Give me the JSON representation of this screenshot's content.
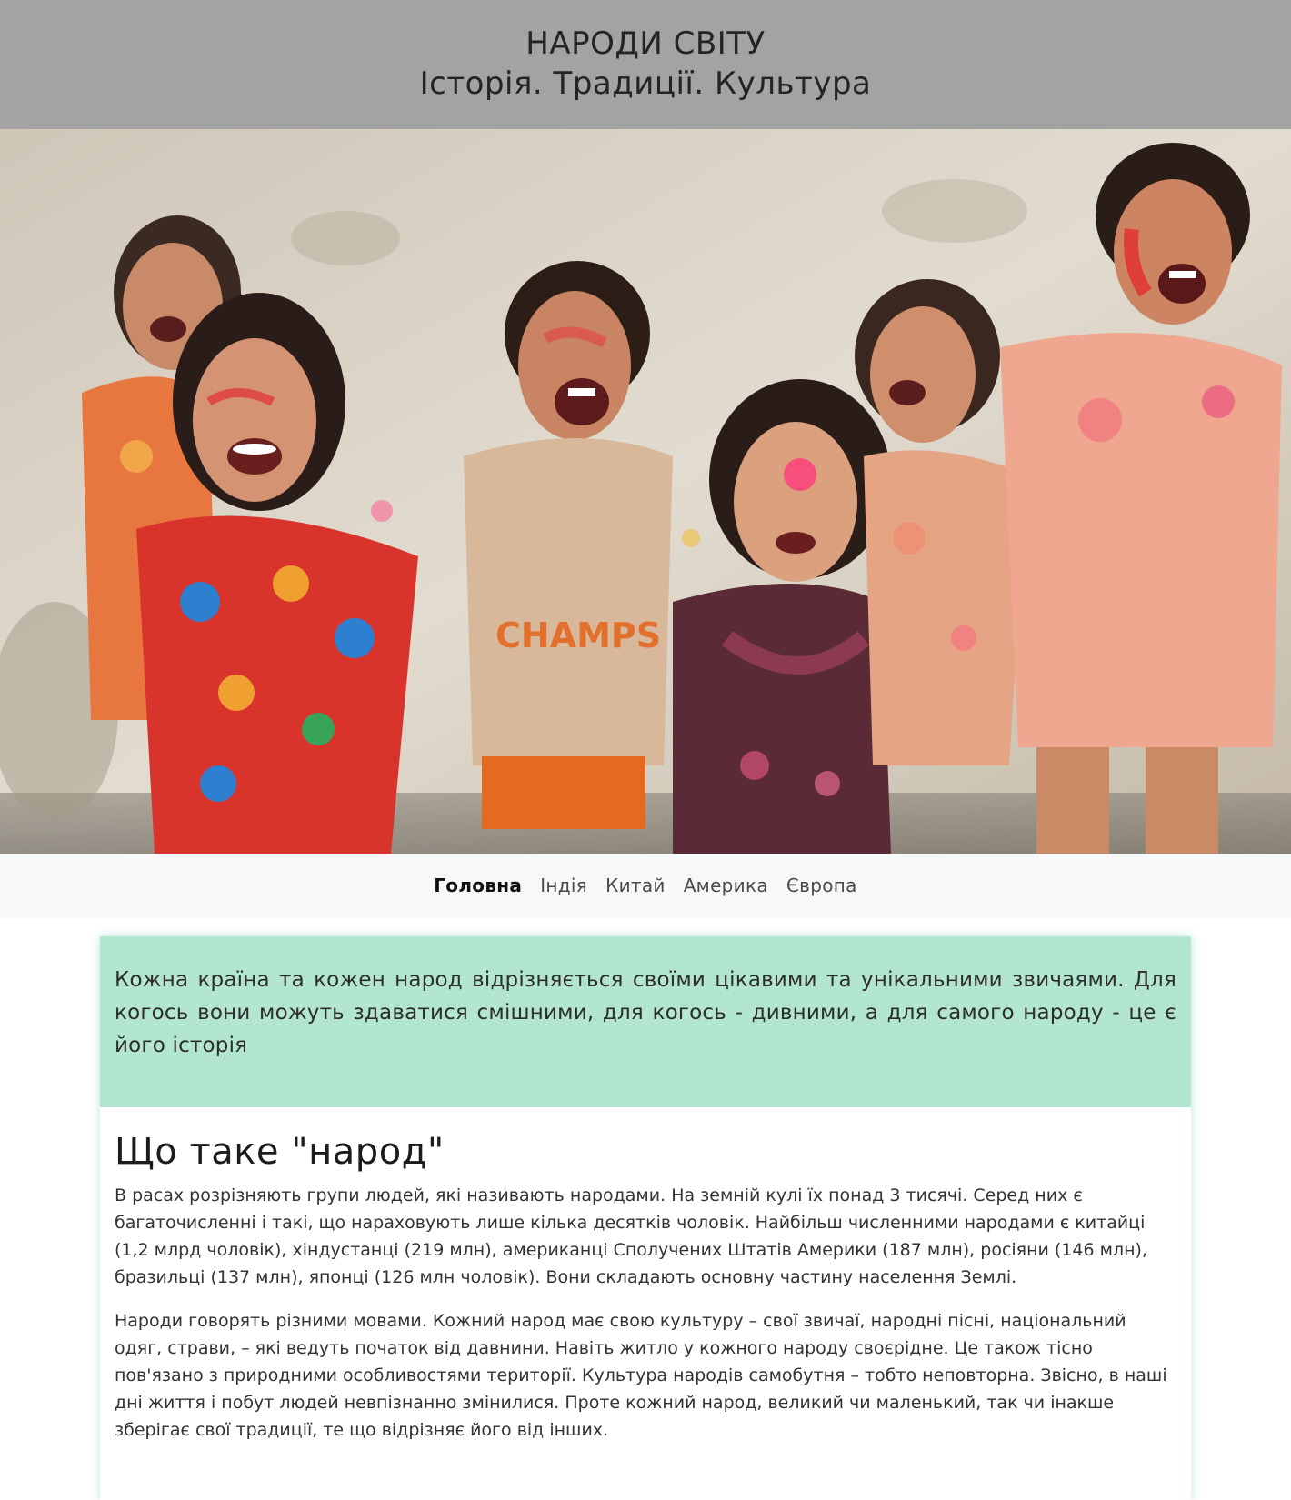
{
  "header": {
    "title": "НАРОДИ СВІТУ",
    "subtitle": "Історія. Традиції. Культура"
  },
  "hero": {
    "subject": "laughing children covered in colored powder"
  },
  "nav": {
    "items": [
      {
        "label": "Головна",
        "active": true
      },
      {
        "label": "Індія",
        "active": false
      },
      {
        "label": "Китай",
        "active": false
      },
      {
        "label": "Америка",
        "active": false
      },
      {
        "label": "Європа",
        "active": false
      }
    ]
  },
  "intro": {
    "text": "Кожна країна та кожен народ відрізняється своїми цікавими та унікальними звичаями. Для когось вони можуть здаватися смішними, для когось - дивними, а для самого народу - це є його історія"
  },
  "article": {
    "heading": "Що таке \"народ\"",
    "paragraphs": [
      "В расах розрізняють групи людей, які називають народами. На земній кулі їх понад 3 тисячі. Серед них є багаточисленні і такі, що нараховують лише кілька десятків чоловік. Найбільш численними народами є китайці (1,2 млрд чоловік), хіндустанці (219 млн), американці Сполучених Штатів Америки (187 млн), росіяни (146 млн), бразильці (137 млн), японці (126 млн чоловік). Вони складають основну частину населення Землі.",
      "Народи говорять різними мовами. Кожний народ має свою культуру – свої звичаї, народні пісні, національний одяг, страви, – які ведуть початок від давнини. Навіть житло у кожного народу своєрідне. Це також тісно пов'язано з природними особливостями території. Культура народів самобутня – тобто неповторна. Звісно, в наші дні життя і побут людей невпізнанно змінилися. Проте кожний народ, великий чи маленький, так чи інакше зберігає свої традиції, те що відрізняє його від інших."
    ]
  },
  "colors": {
    "header_bg": "#a3a3a3",
    "nav_bg": "#f7f8f9",
    "intro_bg": "#b3e6cf"
  }
}
